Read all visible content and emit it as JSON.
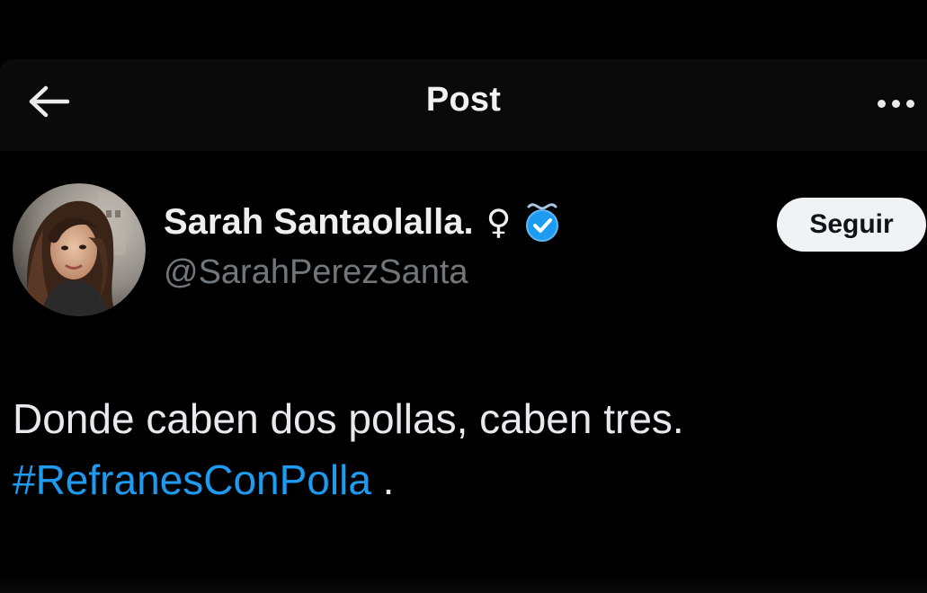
{
  "header": {
    "back_icon": "arrow-left-icon",
    "title": "Post",
    "more_icon": "more-horizontal-icon"
  },
  "author": {
    "display_name": "Sarah Santaolalla.",
    "gender_symbol": "♀",
    "verified_icon": "verified-badge-icon",
    "handle": "@SarahPerezSanta",
    "follow_label": "Seguir"
  },
  "tweet": {
    "text_line1": "Donde caben dos pollas, caben tres.",
    "hashtag": "#RefranesConPolla",
    "trailing": " ."
  },
  "colors": {
    "background": "#000000",
    "text": "#e7e9ea",
    "muted": "#71767b",
    "link": "#1d9bf0",
    "verified": "#1d9bf0",
    "button_bg": "#eff3f4"
  }
}
